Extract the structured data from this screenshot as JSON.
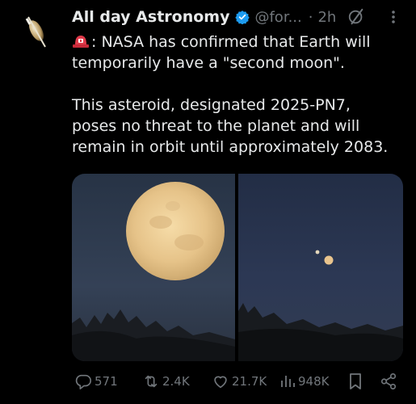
{
  "author": {
    "display_name": "All day Astronomy",
    "handle": "@for...",
    "separator": "·",
    "time": "2h"
  },
  "tweet": {
    "line1": ": NASA has confirmed that Earth will",
    "line2": "temporarily have a \"second moon\".",
    "line3": "This asteroid, designated 2025-PN7,",
    "line4": "poses no threat to the planet and will",
    "line5": "remain in orbit until approximately 2083."
  },
  "actions": {
    "replies": "571",
    "reposts": "2.4K",
    "likes": "21.7K",
    "views": "948K"
  },
  "colors": {
    "background": "#000000",
    "text": "#e7e9ea",
    "muted": "#71767b",
    "verified": "#1d9bf0",
    "siren": "#e0245e"
  },
  "icons": [
    "verified-badge-icon",
    "grok-icon",
    "more-icon",
    "siren-emoji-icon",
    "reply-icon",
    "repost-icon",
    "like-icon",
    "views-icon",
    "bookmark-icon",
    "share-icon"
  ]
}
